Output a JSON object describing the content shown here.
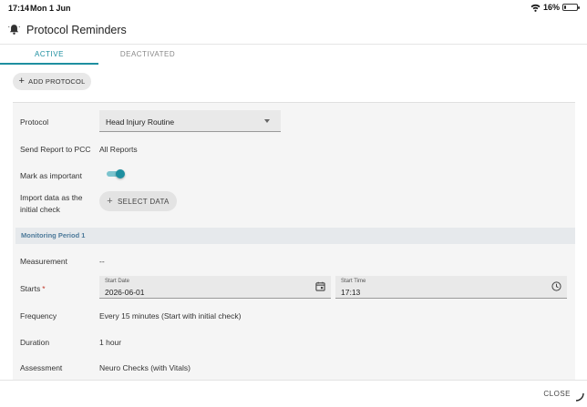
{
  "status_bar": {
    "time": "17:14",
    "date": "Mon 1 Jun",
    "battery": "16%",
    "battery_level": 0.16
  },
  "header": {
    "title": "Protocol Reminders",
    "icon": "bell-icon"
  },
  "tabs": [
    {
      "label": "ACTIVE",
      "active": true
    },
    {
      "label": "DEACTIVATED",
      "active": false
    }
  ],
  "add_protocol_label": "ADD PROTOCOL",
  "form": {
    "protocol_label": "Protocol",
    "protocol_value": "Head Injury Routine",
    "send_report_label": "Send Report to PCC",
    "send_report_value": "All Reports",
    "mark_important_label": "Mark as important",
    "mark_important_on": true,
    "import_label_line1": "Import data as the",
    "import_label_line2": "initial check",
    "select_data_label": "SELECT DATA",
    "period_title": "Monitoring Period 1",
    "measurement_label": "Measurement",
    "measurement_value": "--",
    "starts_label": "Starts",
    "starts_required": "*",
    "start_date_label": "Start Date",
    "start_date_value": "2026-06-01",
    "start_time_label": "Start Time",
    "start_time_value": "17:13",
    "frequency_label": "Frequency",
    "frequency_value": "Every 15 minutes (Start with initial check)",
    "duration_label": "Duration",
    "duration_value": "1 hour",
    "assessment_label": "Assessment",
    "assessment_value": "Neuro Checks (with Vitals)"
  },
  "footer": {
    "close_label": "CLOSE"
  },
  "colors": {
    "accent": "#1e8fa0",
    "section_text": "#4d7a9a",
    "required": "#c0392b"
  }
}
